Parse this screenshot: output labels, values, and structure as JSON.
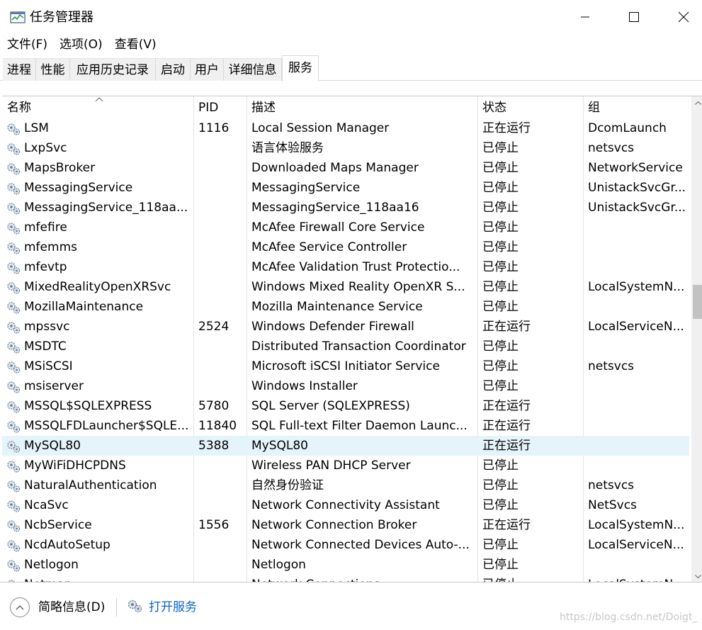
{
  "window": {
    "title": "任务管理器",
    "minimize_icon": "minimize-icon",
    "maximize_icon": "maximize-icon",
    "close_icon": "close-icon"
  },
  "menu": [
    "文件(F)",
    "选项(O)",
    "查看(V)"
  ],
  "tabs": [
    "进程",
    "性能",
    "应用历史记录",
    "启动",
    "用户",
    "详细信息",
    "服务"
  ],
  "active_tab": "服务",
  "columns": {
    "name": "名称",
    "pid": "PID",
    "desc": "描述",
    "status": "状态",
    "group": "组"
  },
  "services": [
    {
      "name": "LSM",
      "pid": "1116",
      "desc": "Local Session Manager",
      "status": "正在运行",
      "group": "DcomLaunch"
    },
    {
      "name": "LxpSvc",
      "pid": "",
      "desc": "语言体验服务",
      "status": "已停止",
      "group": "netsvcs"
    },
    {
      "name": "MapsBroker",
      "pid": "",
      "desc": "Downloaded Maps Manager",
      "status": "已停止",
      "group": "NetworkService"
    },
    {
      "name": "MessagingService",
      "pid": "",
      "desc": "MessagingService",
      "status": "已停止",
      "group": "UnistackSvcGr..."
    },
    {
      "name": "MessagingService_118aa...",
      "pid": "",
      "desc": "MessagingService_118aa16",
      "status": "已停止",
      "group": "UnistackSvcGr..."
    },
    {
      "name": "mfefire",
      "pid": "",
      "desc": "McAfee Firewall Core Service",
      "status": "已停止",
      "group": ""
    },
    {
      "name": "mfemms",
      "pid": "",
      "desc": "McAfee Service Controller",
      "status": "已停止",
      "group": ""
    },
    {
      "name": "mfevtp",
      "pid": "",
      "desc": "McAfee Validation Trust Protectio...",
      "status": "已停止",
      "group": ""
    },
    {
      "name": "MixedRealityOpenXRSvc",
      "pid": "",
      "desc": "Windows Mixed Reality OpenXR S...",
      "status": "已停止",
      "group": "LocalSystemN..."
    },
    {
      "name": "MozillaMaintenance",
      "pid": "",
      "desc": "Mozilla Maintenance Service",
      "status": "已停止",
      "group": ""
    },
    {
      "name": "mpssvc",
      "pid": "2524",
      "desc": "Windows Defender Firewall",
      "status": "正在运行",
      "group": "LocalServiceN..."
    },
    {
      "name": "MSDTC",
      "pid": "",
      "desc": "Distributed Transaction Coordinator",
      "status": "已停止",
      "group": ""
    },
    {
      "name": "MSiSCSI",
      "pid": "",
      "desc": "Microsoft iSCSI Initiator Service",
      "status": "已停止",
      "group": "netsvcs"
    },
    {
      "name": "msiserver",
      "pid": "",
      "desc": "Windows Installer",
      "status": "已停止",
      "group": ""
    },
    {
      "name": "MSSQL$SQLEXPRESS",
      "pid": "5780",
      "desc": "SQL Server (SQLEXPRESS)",
      "status": "正在运行",
      "group": ""
    },
    {
      "name": "MSSQLFDLauncher$SQLE...",
      "pid": "11840",
      "desc": "SQL Full-text Filter Daemon Launc...",
      "status": "正在运行",
      "group": ""
    },
    {
      "name": "MySQL80",
      "pid": "5388",
      "desc": "MySQL80",
      "status": "正在运行",
      "group": "",
      "selected": true
    },
    {
      "name": "MyWiFiDHCPDNS",
      "pid": "",
      "desc": "Wireless PAN DHCP Server",
      "status": "已停止",
      "group": ""
    },
    {
      "name": "NaturalAuthentication",
      "pid": "",
      "desc": "自然身份验证",
      "status": "已停止",
      "group": "netsvcs"
    },
    {
      "name": "NcaSvc",
      "pid": "",
      "desc": "Network Connectivity Assistant",
      "status": "已停止",
      "group": "NetSvcs"
    },
    {
      "name": "NcbService",
      "pid": "1556",
      "desc": "Network Connection Broker",
      "status": "正在运行",
      "group": "LocalSystemN..."
    },
    {
      "name": "NcdAutoSetup",
      "pid": "",
      "desc": "Network Connected Devices Auto-...",
      "status": "已停止",
      "group": "LocalServiceN..."
    },
    {
      "name": "Netlogon",
      "pid": "",
      "desc": "Netlogon",
      "status": "已停止",
      "group": ""
    },
    {
      "name": "Netman",
      "pid": "",
      "desc": "Network Connections",
      "status": "已停止",
      "group": "LocalSystemN..."
    }
  ],
  "footer": {
    "less_details": "简略信息(D)",
    "open_services": "打开服务",
    "watermark": "https://blog.csdn.net/Doigt_"
  },
  "colors": {
    "selected_row": "#e5f3fb",
    "link": "#0a63c9"
  }
}
